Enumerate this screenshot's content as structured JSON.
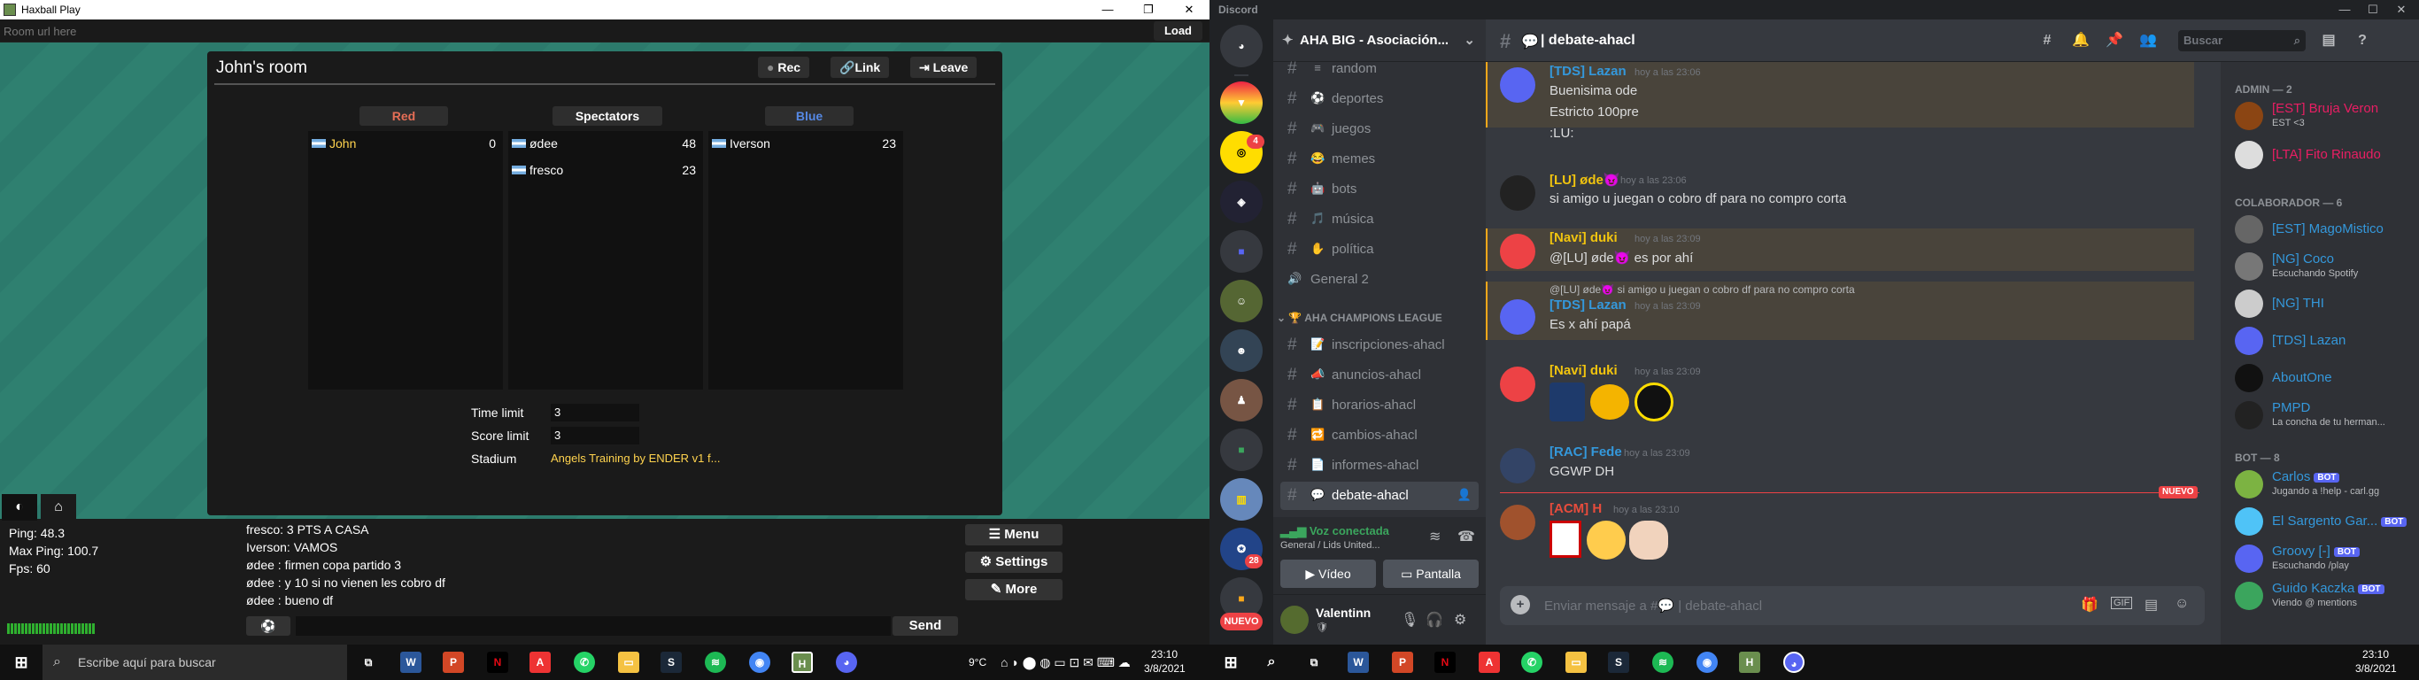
{
  "haxball": {
    "window_title": "Haxball Play",
    "url_placeholder": "Room url here",
    "load_label": "Load",
    "room_title": "John's room",
    "buttons": {
      "rec": "Rec",
      "link": "Link",
      "leave": "Leave"
    },
    "teams": {
      "red": {
        "label": "Red",
        "players": [
          {
            "name": "John",
            "ping": "0"
          }
        ]
      },
      "spec": {
        "label": "Spectators",
        "players": [
          {
            "name": "ødee",
            "ping": "48"
          },
          {
            "name": "fresco",
            "ping": "23"
          }
        ]
      },
      "blue": {
        "label": "Blue",
        "players": [
          {
            "name": "Iverson",
            "ping": "23"
          }
        ]
      }
    },
    "settings": {
      "time_label": "Time limit",
      "time_value": "3",
      "score_label": "Score limit",
      "score_value": "3",
      "stadium_label": "Stadium",
      "stadium_value": "Angels Training by ENDER v1 f..."
    },
    "stats": {
      "ping": "Ping: 48.3",
      "max_ping": "Max Ping: 100.7",
      "fps": "Fps: 60"
    },
    "chat": [
      "fresco: 3 PTS A CASA",
      "Iverson: VAMOS",
      "ødee : firmen copa partido 3",
      "ødee : y 10 si no vienen les cobro df",
      "ødee : bueno df"
    ],
    "menu": {
      "menu": "Menu",
      "settings": "Settings",
      "more": "More"
    },
    "send_label": "Send"
  },
  "taskbar_left": {
    "search_placeholder": "Escribe aquí para buscar",
    "weather": "9°C",
    "time": "23:10",
    "date": "3/8/2021"
  },
  "taskbar_right": {
    "time": "23:10",
    "date": "3/8/2021"
  },
  "discord": {
    "window_title": "Discord",
    "server_name": "AHA BIG - Asociación...",
    "guild_badges": {
      "g1": "4",
      "g2": "28"
    },
    "nuevo_label": "NUEVO",
    "channels": [
      {
        "name": "random",
        "icon": "≡"
      },
      {
        "name": "deportes",
        "icon": "⚽"
      },
      {
        "name": "juegos",
        "icon": "🎮"
      },
      {
        "name": "memes",
        "icon": "😂"
      },
      {
        "name": "bots",
        "icon": "🤖"
      },
      {
        "name": "música",
        "icon": "🎵"
      },
      {
        "name": "política",
        "icon": "✋"
      },
      {
        "name": "General 2",
        "icon": "🔊"
      }
    ],
    "category": "AHA CHAMPIONS LEAGUE",
    "league_channels": [
      {
        "name": "inscripciones-ahacl",
        "icon": "📝"
      },
      {
        "name": "anuncios-ahacl",
        "icon": "📣"
      },
      {
        "name": "horarios-ahacl",
        "icon": "📋"
      },
      {
        "name": "cambios-ahacl",
        "icon": "🔁"
      },
      {
        "name": "informes-ahacl",
        "icon": "📄"
      },
      {
        "name": "debate-ahacl",
        "icon": "💬"
      }
    ],
    "voice": {
      "status": "Voz conectada",
      "channel": "General / Lids United...",
      "video": "Vídeo",
      "screen": "Pantalla"
    },
    "user": {
      "name": "Valentinn"
    },
    "channel_header": "debate-ahacl",
    "search_placeholder": "Buscar",
    "messages": [
      {
        "user": "[TDS] Lazan",
        "time": "hoy a las 23:06",
        "lines": [
          "Buenisima ode",
          "Estricto 100pre",
          ":LU:"
        ]
      },
      {
        "user": "[LU] øde😈",
        "time": "hoy a las 23:06",
        "lines": [
          "si amigo u juegan o cobro df para no compro corta"
        ]
      },
      {
        "user": "[Navi] duki",
        "time": "hoy a las 23:09",
        "lines": [
          "@[LU] øde😈  es por ahí"
        ]
      },
      {
        "reply": "@[LU] øde😈 si amigo u juegan o cobro df para no compro corta",
        "user": "[TDS] Lazan",
        "time": "hoy a las 23:09",
        "lines": [
          "Es x ahí papá"
        ]
      },
      {
        "user": "[Navi] duki",
        "time": "hoy a las 23:09",
        "lines": []
      },
      {
        "user": "[RAC] Fede",
        "time": "hoy a las 23:09",
        "lines": [
          "GGWP DH"
        ]
      },
      {
        "user": "[ACM] H",
        "time": "hoy a las 23:10",
        "lines": []
      }
    ],
    "new_label": "NUEVO",
    "input_placeholder": "Enviar mensaje a #💬 | debate-ahacl",
    "members": {
      "admin_header": "ADMIN — 2",
      "admins": [
        {
          "name": "[EST] Bruja Veron",
          "status": "EST <3",
          "color": "#e91e63"
        },
        {
          "name": "[LTA] Fito Rinaudo",
          "status": "",
          "color": "#e91e63"
        }
      ],
      "colab_header": "COLABORADOR — 6",
      "colabs": [
        {
          "name": "[EST] MagoMistico",
          "status": "",
          "color": "#3498db"
        },
        {
          "name": "[NG] Coco",
          "status": "Escuchando Spotify",
          "color": "#3498db"
        },
        {
          "name": "[NG] THI",
          "status": "",
          "color": "#3498db"
        },
        {
          "name": "[TDS] Lazan",
          "status": "",
          "color": "#3498db"
        },
        {
          "name": "AboutOne",
          "status": "",
          "color": "#3498db"
        },
        {
          "name": "PMPD",
          "status": "La concha de tu herman...",
          "color": "#3498db"
        }
      ],
      "bot_header": "BOT — 8",
      "bots": [
        {
          "name": "Carlos",
          "status": "Jugando a !help - carl.gg",
          "color": "#3498db"
        },
        {
          "name": "El Sargento Gar...",
          "status": "",
          "color": "#3498db"
        },
        {
          "name": "Groovy [-]",
          "status": "Escuchando /play",
          "color": "#3498db"
        },
        {
          "name": "Guido Kaczka",
          "status": "Viendo @ mentions",
          "color": "#3498db"
        }
      ],
      "bot_badge": "BOT"
    }
  }
}
